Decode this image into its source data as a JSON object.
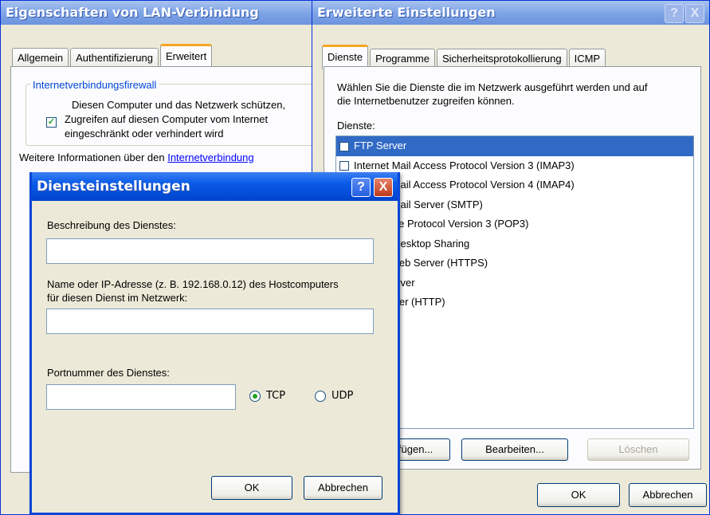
{
  "lan": {
    "title": "Eigenschaften von LAN-Verbindung",
    "tabs": [
      "Allgemein",
      "Authentifizierung",
      "Erweitert"
    ],
    "firewall_group": "Internetverbindungsfirewall",
    "firewall_text1": "Diesen Computer und das Netzwerk schützen,",
    "firewall_text2": "Zugreifen auf diesen Computer vom Internet",
    "firewall_text3": "eingeschränkt oder verhindert wird",
    "info_prefix": "Weitere Informationen über den ",
    "info_link": "Internetverbindung"
  },
  "adv": {
    "title": "Erweiterte Einstellungen",
    "help": "?",
    "tabs": [
      "Dienste",
      "Programme",
      "Sicherheitsprotokollierung",
      "ICMP"
    ],
    "desc1": "Wählen Sie die Dienste die im Netzwerk ausgeführt werden und auf",
    "desc2": "die Internetbenutzer zugreifen können.",
    "services_label": "Dienste:",
    "services": [
      "FTP Server",
      "Internet Mail Access Protocol Version 3 (IMAP3)",
      "Internet Mail Access Protocol Version 4 (IMAP4)",
      "Internet Mail Server (SMTP)",
      "Post Office Protocol Version 3 (POP3)",
      "Remote Desktop Sharing",
      "Secure Web Server (HTTPS)",
      "Telnet Server",
      "Web Server (HTTP)"
    ],
    "add_button": "Hinzufügen...",
    "edit_button": "Bearbeiten...",
    "delete_button": "Löschen",
    "ok_button": "OK",
    "cancel_button": "Abbrechen"
  },
  "svc": {
    "title": "Diensteinstellungen",
    "help": "?",
    "close": "X",
    "desc_label": "Beschreibung des Dienstes:",
    "desc_value": "",
    "host_label1": "Name oder IP-Adresse (z. B. 192.168.0.12) des Hostcomputers",
    "host_label2": "für diesen Dienst im Netzwerk:",
    "host_value": "",
    "port_label": "Portnummer des Dienstes:",
    "port_value": "",
    "tcp": "TCP",
    "udp": "UDP",
    "protocol_selected": "TCP",
    "ok_button": "OK",
    "cancel_button": "Abbrechen"
  }
}
